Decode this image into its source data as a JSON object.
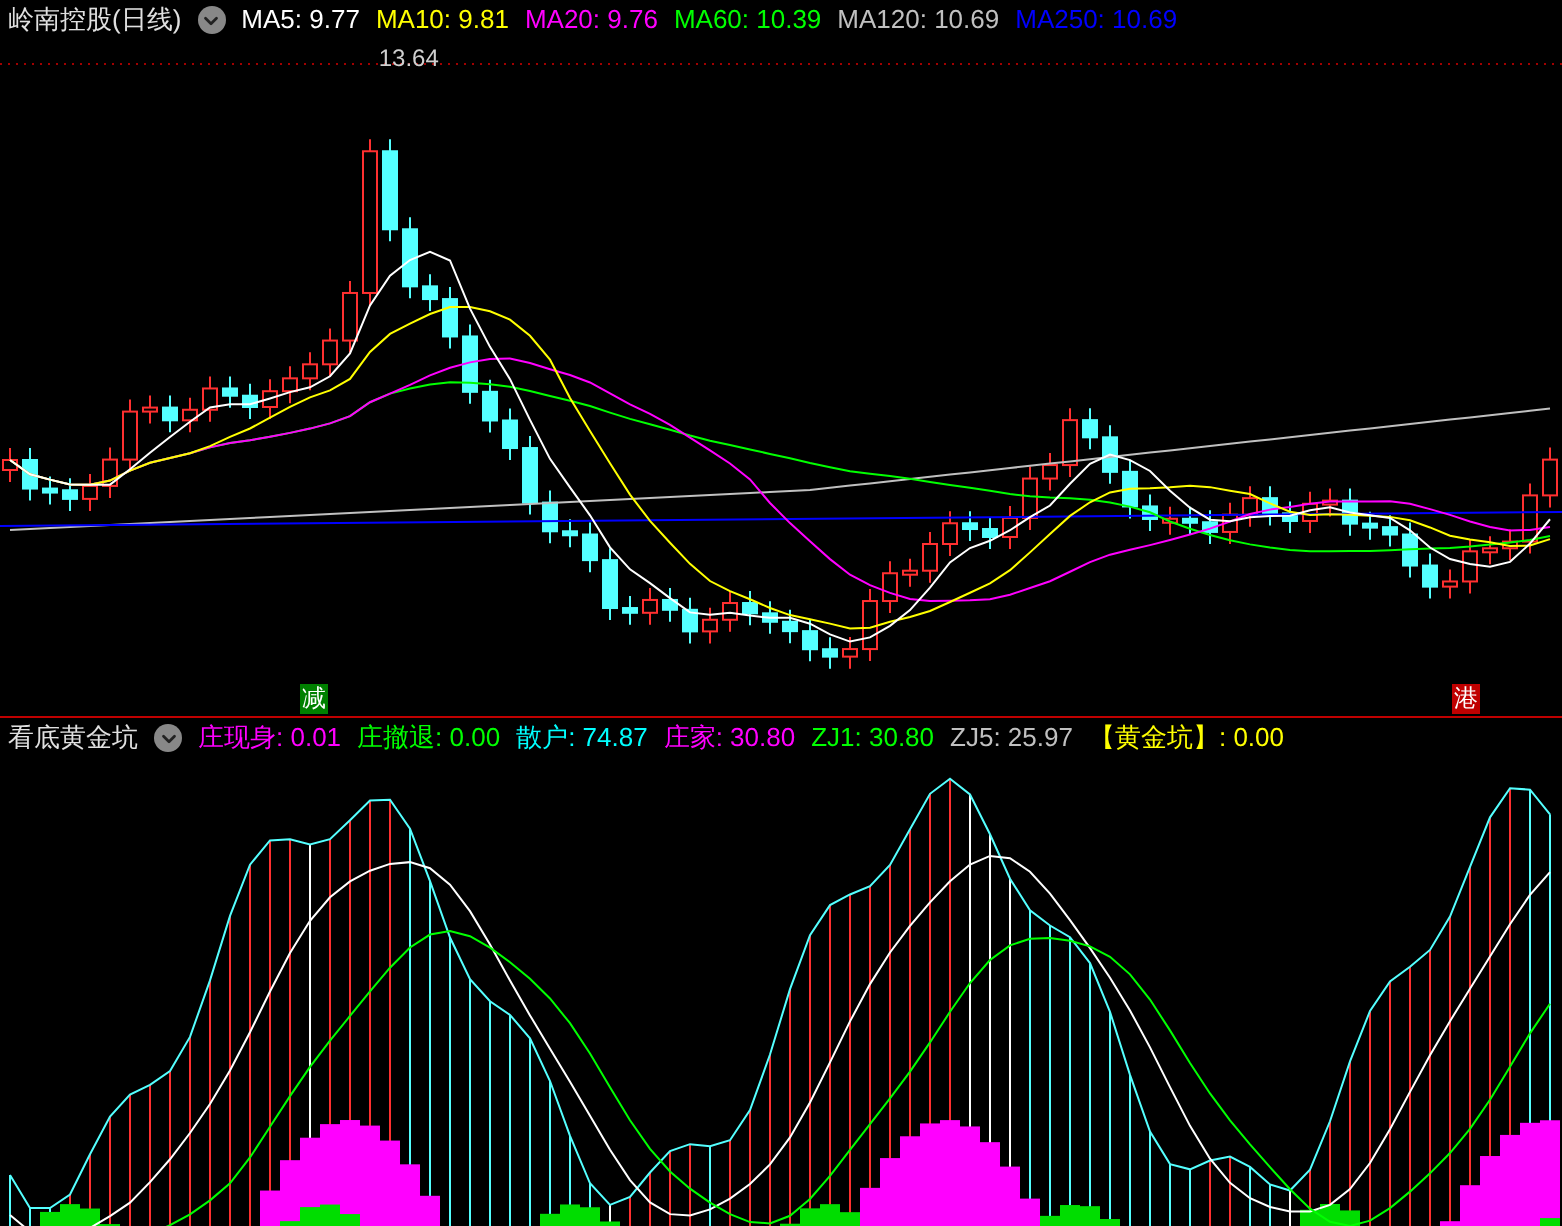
{
  "main_header": {
    "title": "岭南控股(日线)",
    "indicators": [
      {
        "label": "MA5: 9.77",
        "color": "#ffffff"
      },
      {
        "label": "MA10: 9.81",
        "color": "#ffff00"
      },
      {
        "label": "MA20: 9.76",
        "color": "#ff00ff"
      },
      {
        "label": "MA60: 10.39",
        "color": "#00ff00"
      },
      {
        "label": "MA120: 10.69",
        "color": "#c0c0c0"
      },
      {
        "label": "MA250: 10.69",
        "color": "#0000ff"
      }
    ]
  },
  "price_label": "13.64",
  "markers": [
    {
      "text": "减",
      "color": "#008000"
    },
    {
      "text": "港",
      "color": "#c00000"
    }
  ],
  "sub_header": {
    "title": "看底黄金坑",
    "indicators": [
      {
        "label": "庄现身: 0.01",
        "color": "#ff00ff"
      },
      {
        "label": "庄撤退: 0.00",
        "color": "#00ff00"
      },
      {
        "label": "散户: 74.87",
        "color": "#00ffff"
      },
      {
        "label": "庄家: 30.80",
        "color": "#ff00ff"
      },
      {
        "label": "ZJ1: 30.80",
        "color": "#00ff00"
      },
      {
        "label": "ZJ5: 25.97",
        "color": "#c0c0c0"
      },
      {
        "label": "【黄金坑】: 0.00",
        "color": "#ffff00"
      }
    ]
  }
}
